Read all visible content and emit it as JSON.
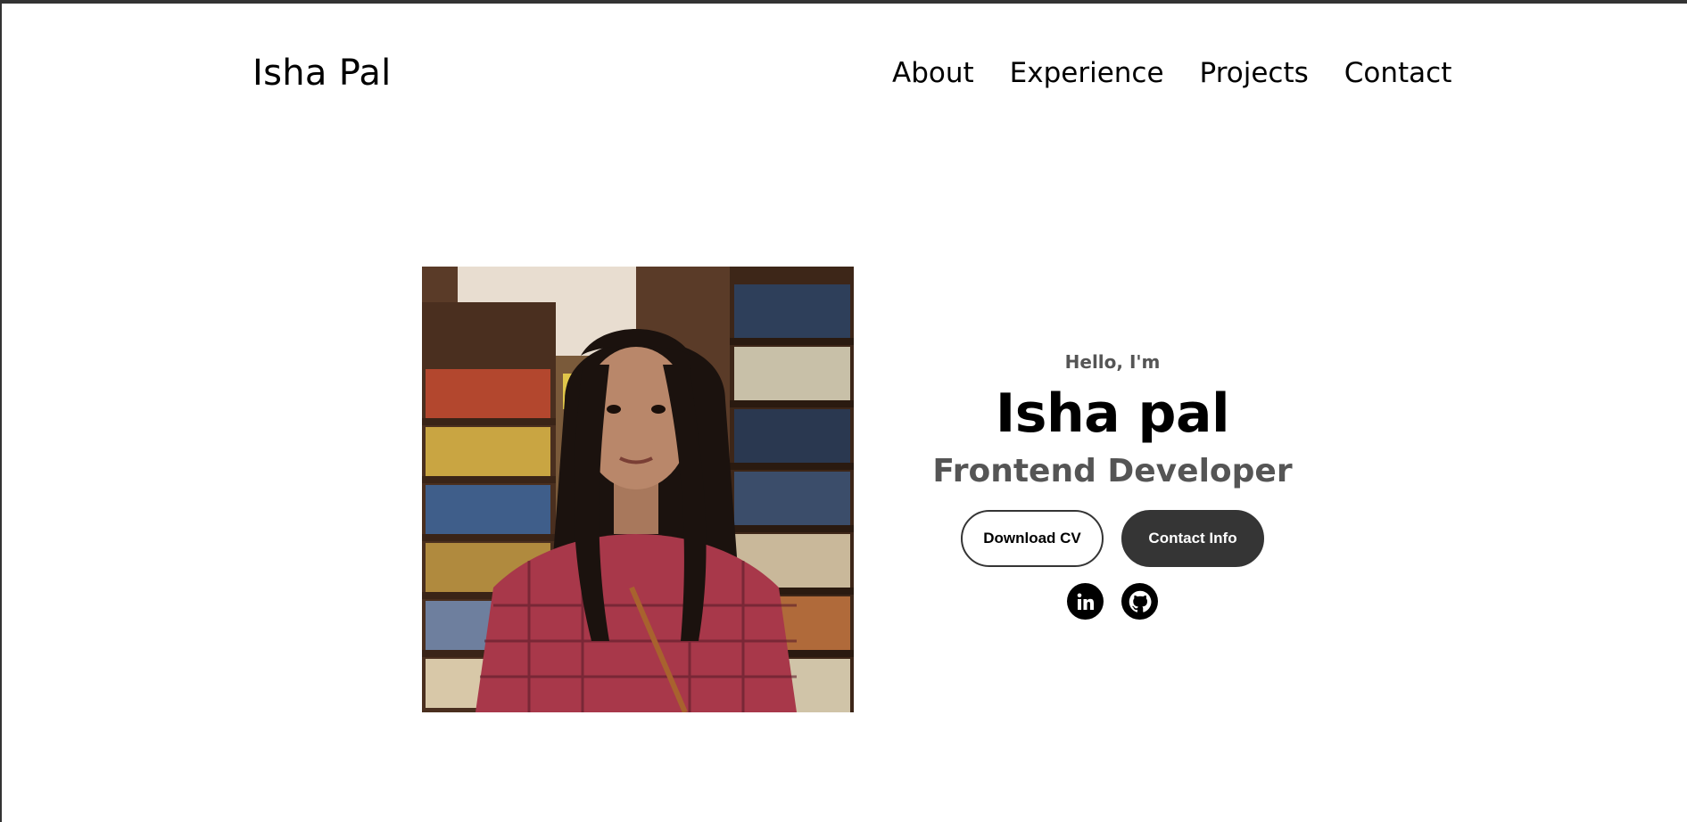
{
  "nav": {
    "logo": "Isha Pal",
    "links": [
      "About",
      "Experience",
      "Projects",
      "Contact"
    ]
  },
  "hero": {
    "greeting": "Hello, I'm",
    "name": "Isha pal",
    "role": "Frontend Developer",
    "download_cv_label": "Download CV",
    "contact_info_label": "Contact Info",
    "socials": [
      {
        "icon": "linkedin-icon",
        "glyph": "in"
      },
      {
        "icon": "github-icon"
      }
    ],
    "profile_image_alt": "profile picture"
  },
  "colors": {
    "dark_button": "#353535",
    "muted_text": "#555555"
  }
}
